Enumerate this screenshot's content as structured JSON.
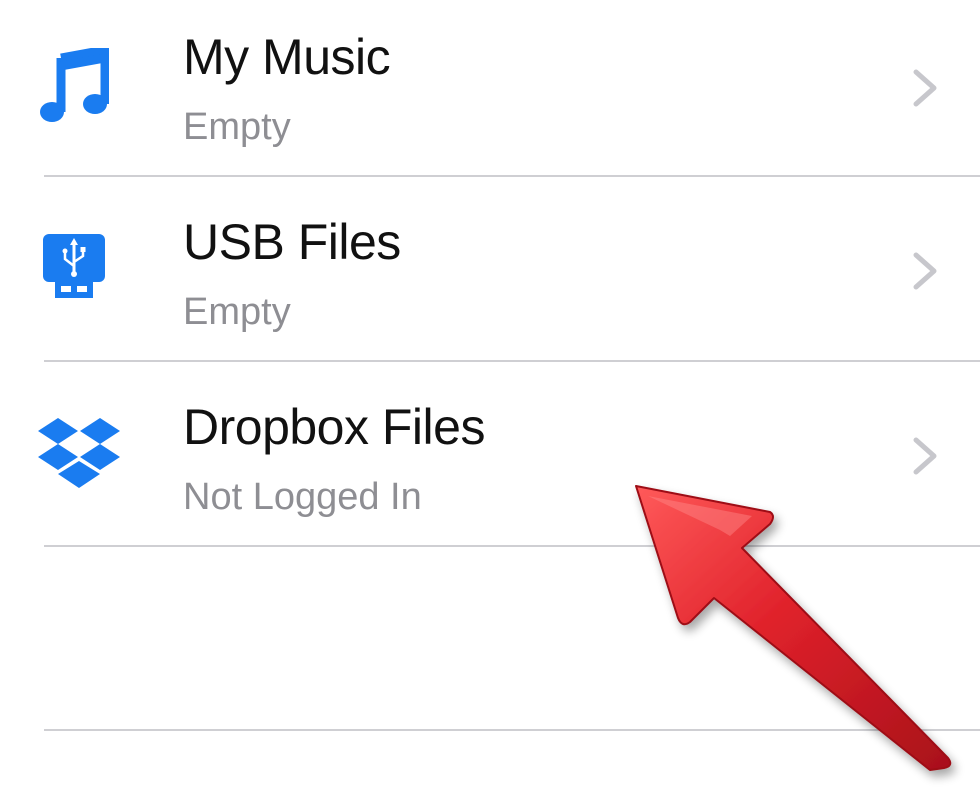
{
  "items": [
    {
      "title": "My Music",
      "subtitle": "Empty",
      "icon": "music-note-icon"
    },
    {
      "title": "USB Files",
      "subtitle": "Empty",
      "icon": "usb-drive-icon"
    },
    {
      "title": "Dropbox Files",
      "subtitle": "Not Logged In",
      "icon": "dropbox-icon"
    }
  ],
  "colors": {
    "accent": "#1a7cf0",
    "title": "#111111",
    "subtitle": "#8e8e93",
    "chevron": "#c7c7cc",
    "separator": "#cfcfd3",
    "annotation_arrow": "#d8202a"
  }
}
